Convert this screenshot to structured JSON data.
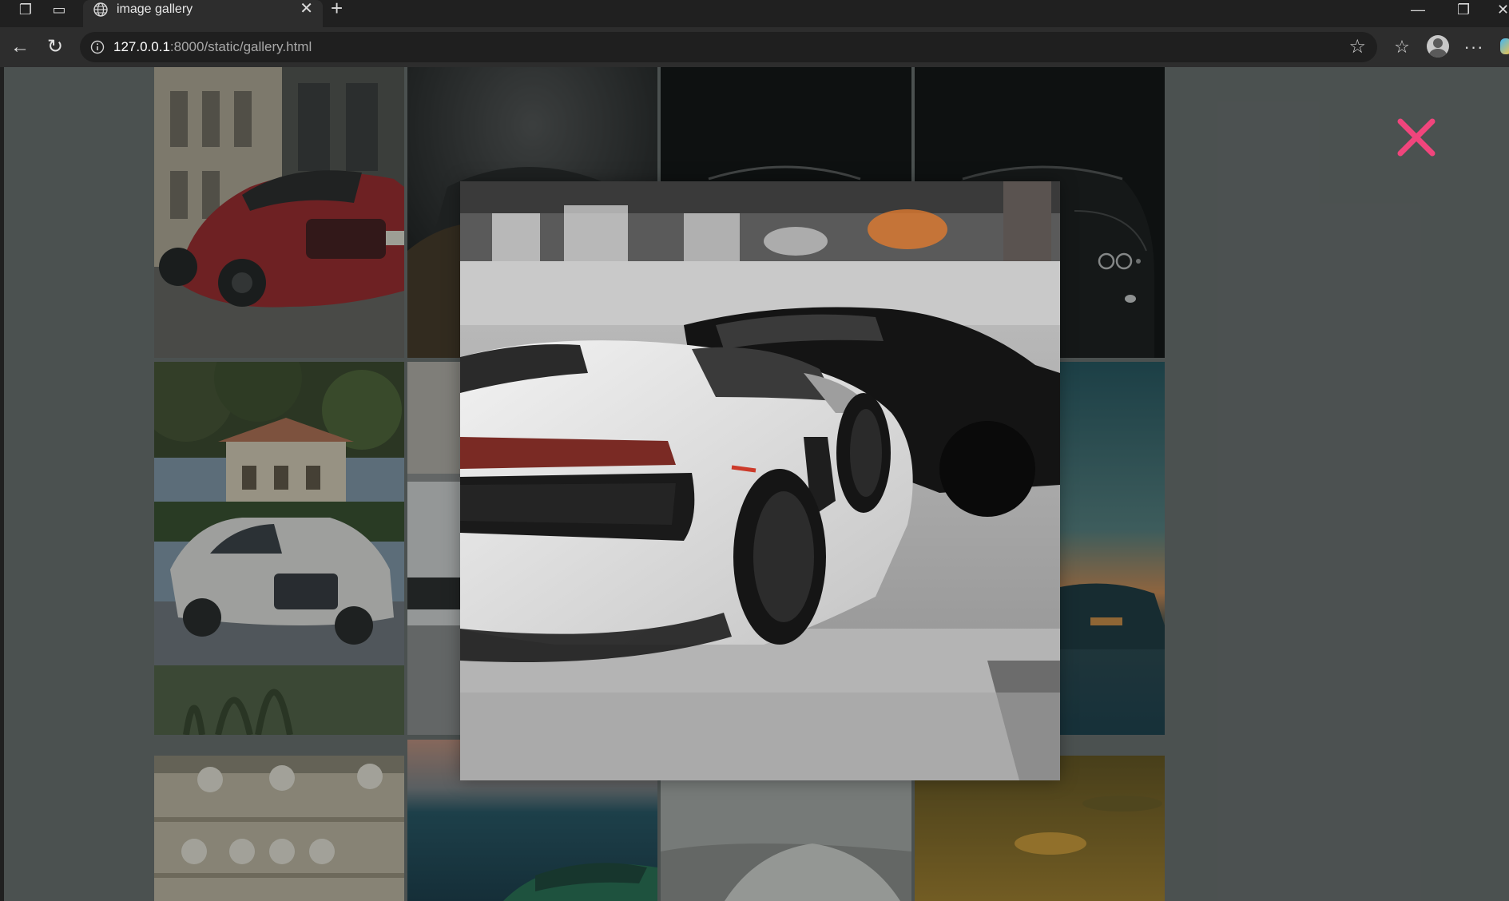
{
  "browser": {
    "tab": {
      "title": "image gallery",
      "close_glyph": "✕",
      "icon": "globe-icon"
    },
    "new_tab_glyph": "+",
    "window_controls": {
      "minimize": "—",
      "maximize": "❐",
      "close": "✕"
    },
    "address": {
      "host": "127.0.0.1",
      "path": ":8000/static/gallery.html",
      "info_icon": "info-icon"
    },
    "nav": {
      "back": "←",
      "reload": "↻"
    },
    "toolbar_icons": {
      "favorite": "☆",
      "favorites_list": "☆",
      "more": "···"
    }
  },
  "page": {
    "background": "#636867",
    "close_button_color": "#f0457c",
    "gallery": {
      "tiles": [
        {
          "subject": "red sports car on city street"
        },
        {
          "subject": "dark car silhouette"
        },
        {
          "subject": "black car on black background"
        },
        {
          "subject": "black car headlights"
        },
        {
          "subject": "white SUV with palm trees"
        },
        {
          "subject": "white supercar partial"
        },
        {
          "subject": "coupe at sunset"
        },
        {
          "subject": "ceiling with round lights"
        },
        {
          "subject": "green car by the sea"
        },
        {
          "subject": "gray car"
        },
        {
          "subject": "golden sky"
        }
      ]
    },
    "lightbox": {
      "subject": "white Lamborghini Aventador parked next to black sports car"
    }
  }
}
